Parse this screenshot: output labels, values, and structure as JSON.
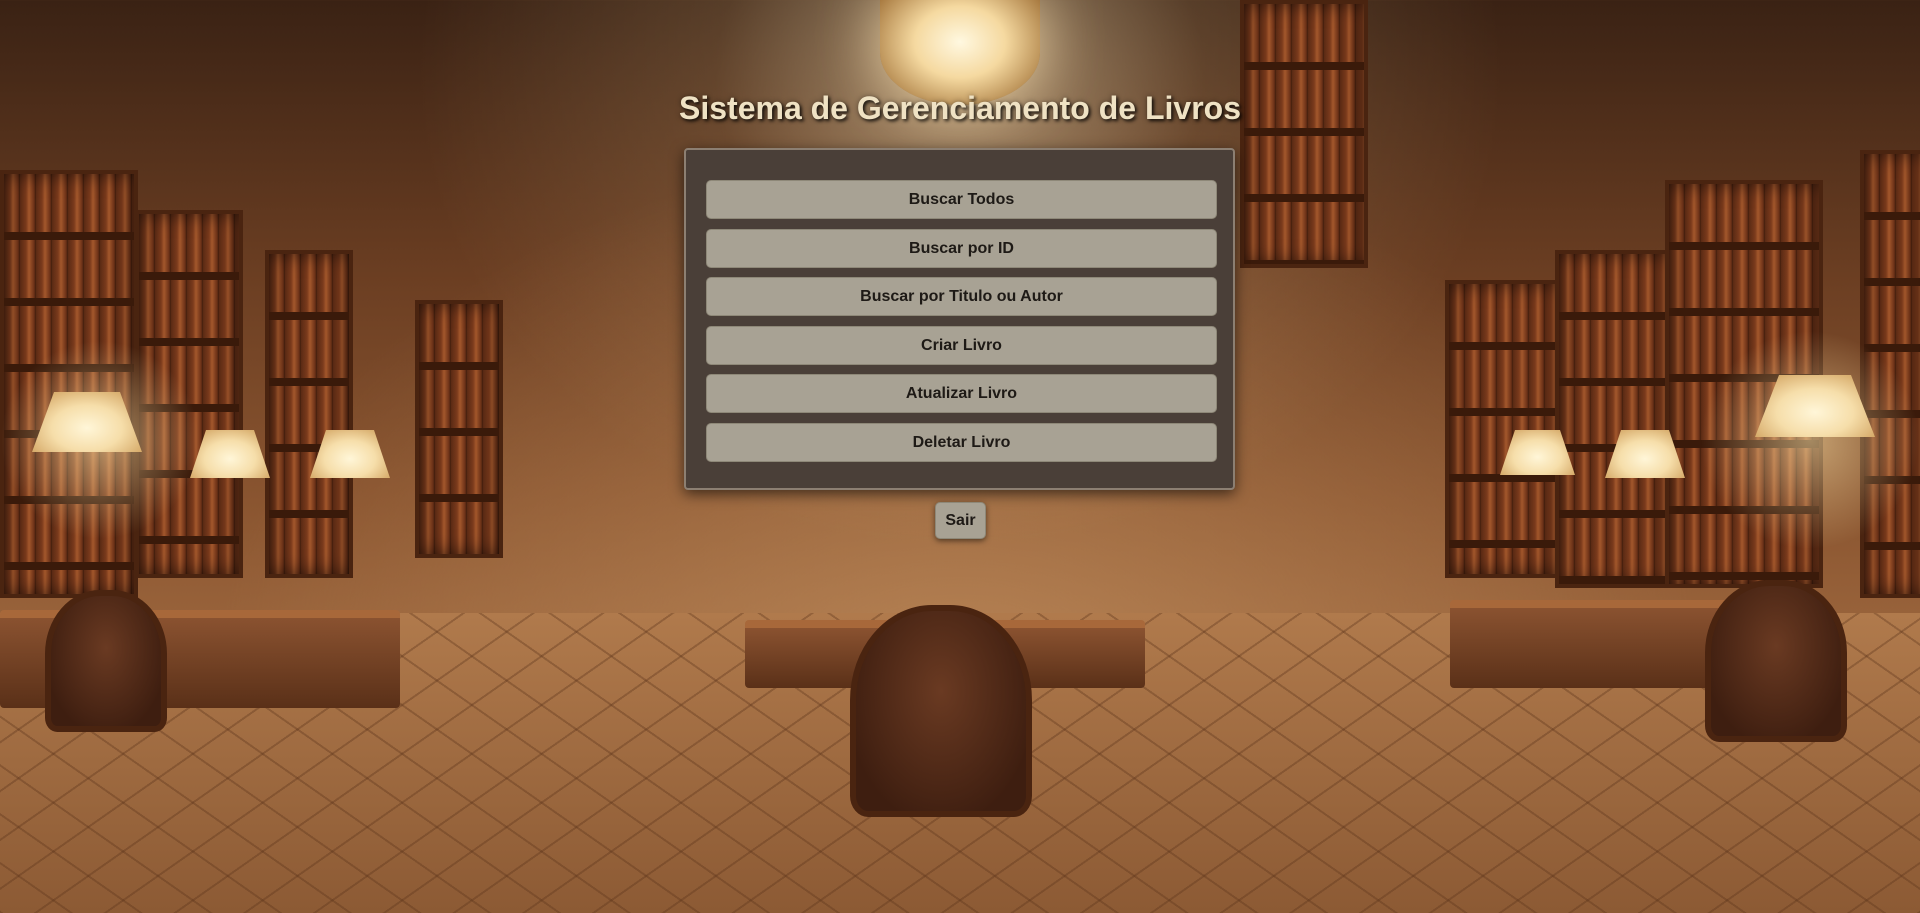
{
  "page": {
    "title": "Sistema de Gerenciamento de Livros"
  },
  "menu": {
    "buttons": [
      {
        "label": "Buscar Todos"
      },
      {
        "label": "Buscar por ID"
      },
      {
        "label": "Buscar por Titulo ou Autor"
      },
      {
        "label": "Criar Livro"
      },
      {
        "label": "Atualizar Livro"
      },
      {
        "label": "Deletar Livro"
      }
    ]
  },
  "exit": {
    "label": "Sair"
  },
  "colors": {
    "panel_background": "#4a3f38",
    "button_background": "#a8a294",
    "title_text": "#efe2c4"
  },
  "background": {
    "icon": "library-interior-image"
  }
}
